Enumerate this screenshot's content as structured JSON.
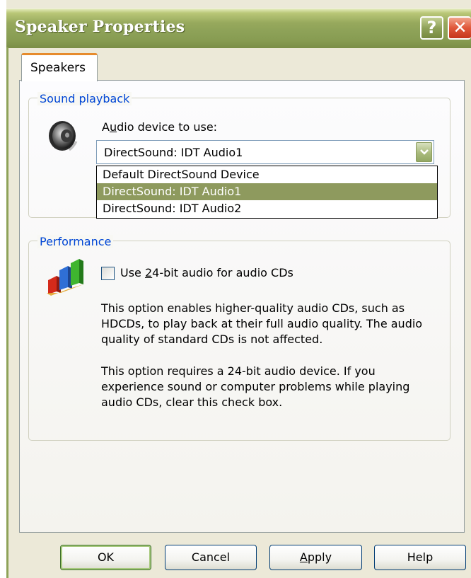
{
  "window": {
    "title": "Speaker Properties",
    "help_glyph": "?",
    "close_glyph": "✕"
  },
  "tabs": [
    {
      "label": "Speakers",
      "active": true
    }
  ],
  "sound_playback": {
    "group_label": "Sound playback",
    "device_label_pre": "A",
    "device_label_accel": "u",
    "device_label_post": "dio device to use:",
    "selected_device": "DirectSound: IDT Audio1",
    "options": [
      "Default DirectSound Device",
      "DirectSound: IDT Audio1",
      "DirectSound: IDT Audio2"
    ],
    "highlighted_option_index": 1
  },
  "performance": {
    "group_label": "Performance",
    "checkbox_pre": "Use ",
    "checkbox_accel": "2",
    "checkbox_post": "4-bit audio for audio CDs",
    "checked": false,
    "description_1": "This option enables higher-quality audio CDs, such as HDCDs, to play back at their full audio quality. The audio quality of standard CDs is not affected.",
    "description_2": "This option requires a 24-bit audio device. If you experience sound or computer problems while playing audio CDs, clear this check box."
  },
  "buttons": {
    "ok": "OK",
    "cancel": "Cancel",
    "apply_accel": "A",
    "apply_rest": "pply",
    "help": "Help"
  },
  "colors": {
    "title_bar": "#8ea258",
    "group_label": "#0046d5",
    "selection": "#8e9a5e",
    "tab_accent": "#e68b2c"
  }
}
